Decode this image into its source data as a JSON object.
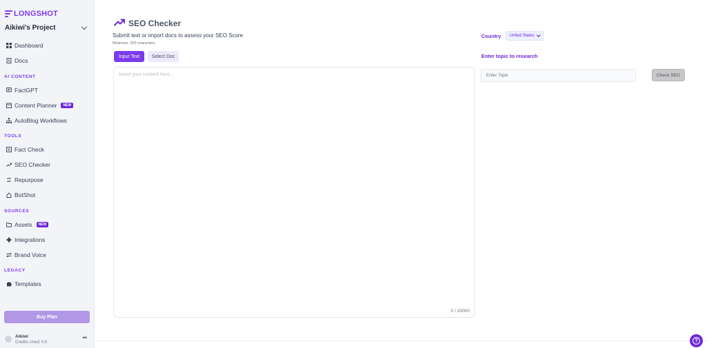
{
  "brand": {
    "name": "LONGSHOT",
    "accent": "#7c3aed"
  },
  "project": {
    "name": "Aikiwi's Project"
  },
  "sidebar": {
    "top_items": [
      {
        "label": "Dashboard",
        "icon": "grid-icon"
      },
      {
        "label": "Docs",
        "icon": "document-icon"
      }
    ],
    "sections": [
      {
        "title": "AI CONTENT",
        "items": [
          {
            "label": "FactGPT",
            "icon": "chat-icon"
          },
          {
            "label": "Content Planner",
            "icon": "calendar-icon",
            "badge": "NEW"
          },
          {
            "label": "AutoBlog Workflows",
            "icon": "workflow-icon"
          }
        ]
      },
      {
        "title": "TOOLS",
        "items": [
          {
            "label": "Fact Check",
            "icon": "checklist-icon"
          },
          {
            "label": "SEO Checker",
            "icon": "trend-icon"
          },
          {
            "label": "Repurpose",
            "icon": "repurpose-icon"
          },
          {
            "label": "BotShot",
            "icon": "bot-icon"
          }
        ]
      },
      {
        "title": "SOURCES",
        "items": [
          {
            "label": "Assets",
            "icon": "folder-icon",
            "badge": "NEW"
          },
          {
            "label": "Integrations",
            "icon": "gear-icon"
          },
          {
            "label": "Brand Voice",
            "icon": "swap-icon"
          }
        ]
      },
      {
        "title": "LEGACY",
        "items": [
          {
            "label": "Templates",
            "icon": "puzzle-icon"
          }
        ]
      }
    ],
    "buy_plan": "Buy Plan",
    "user": {
      "name": "Aikiwi",
      "credits": "Credits Used: 0.0"
    }
  },
  "main": {
    "title": "SEO Checker",
    "subtitle": "Submit text or import docs to assess your SEO Score",
    "min_chars": "Minimum: 200 characters",
    "tabs": {
      "input_text": "Input Text",
      "select_doc": "Select Doc"
    },
    "editor": {
      "placeholder": "Insert your content here...",
      "counter": "0 / 20000"
    },
    "country": {
      "label": "Country",
      "value": "United States"
    },
    "topic": {
      "label": "Enter topic to research",
      "placeholder": "Enter Topic"
    },
    "check_button": "Check SEO"
  }
}
